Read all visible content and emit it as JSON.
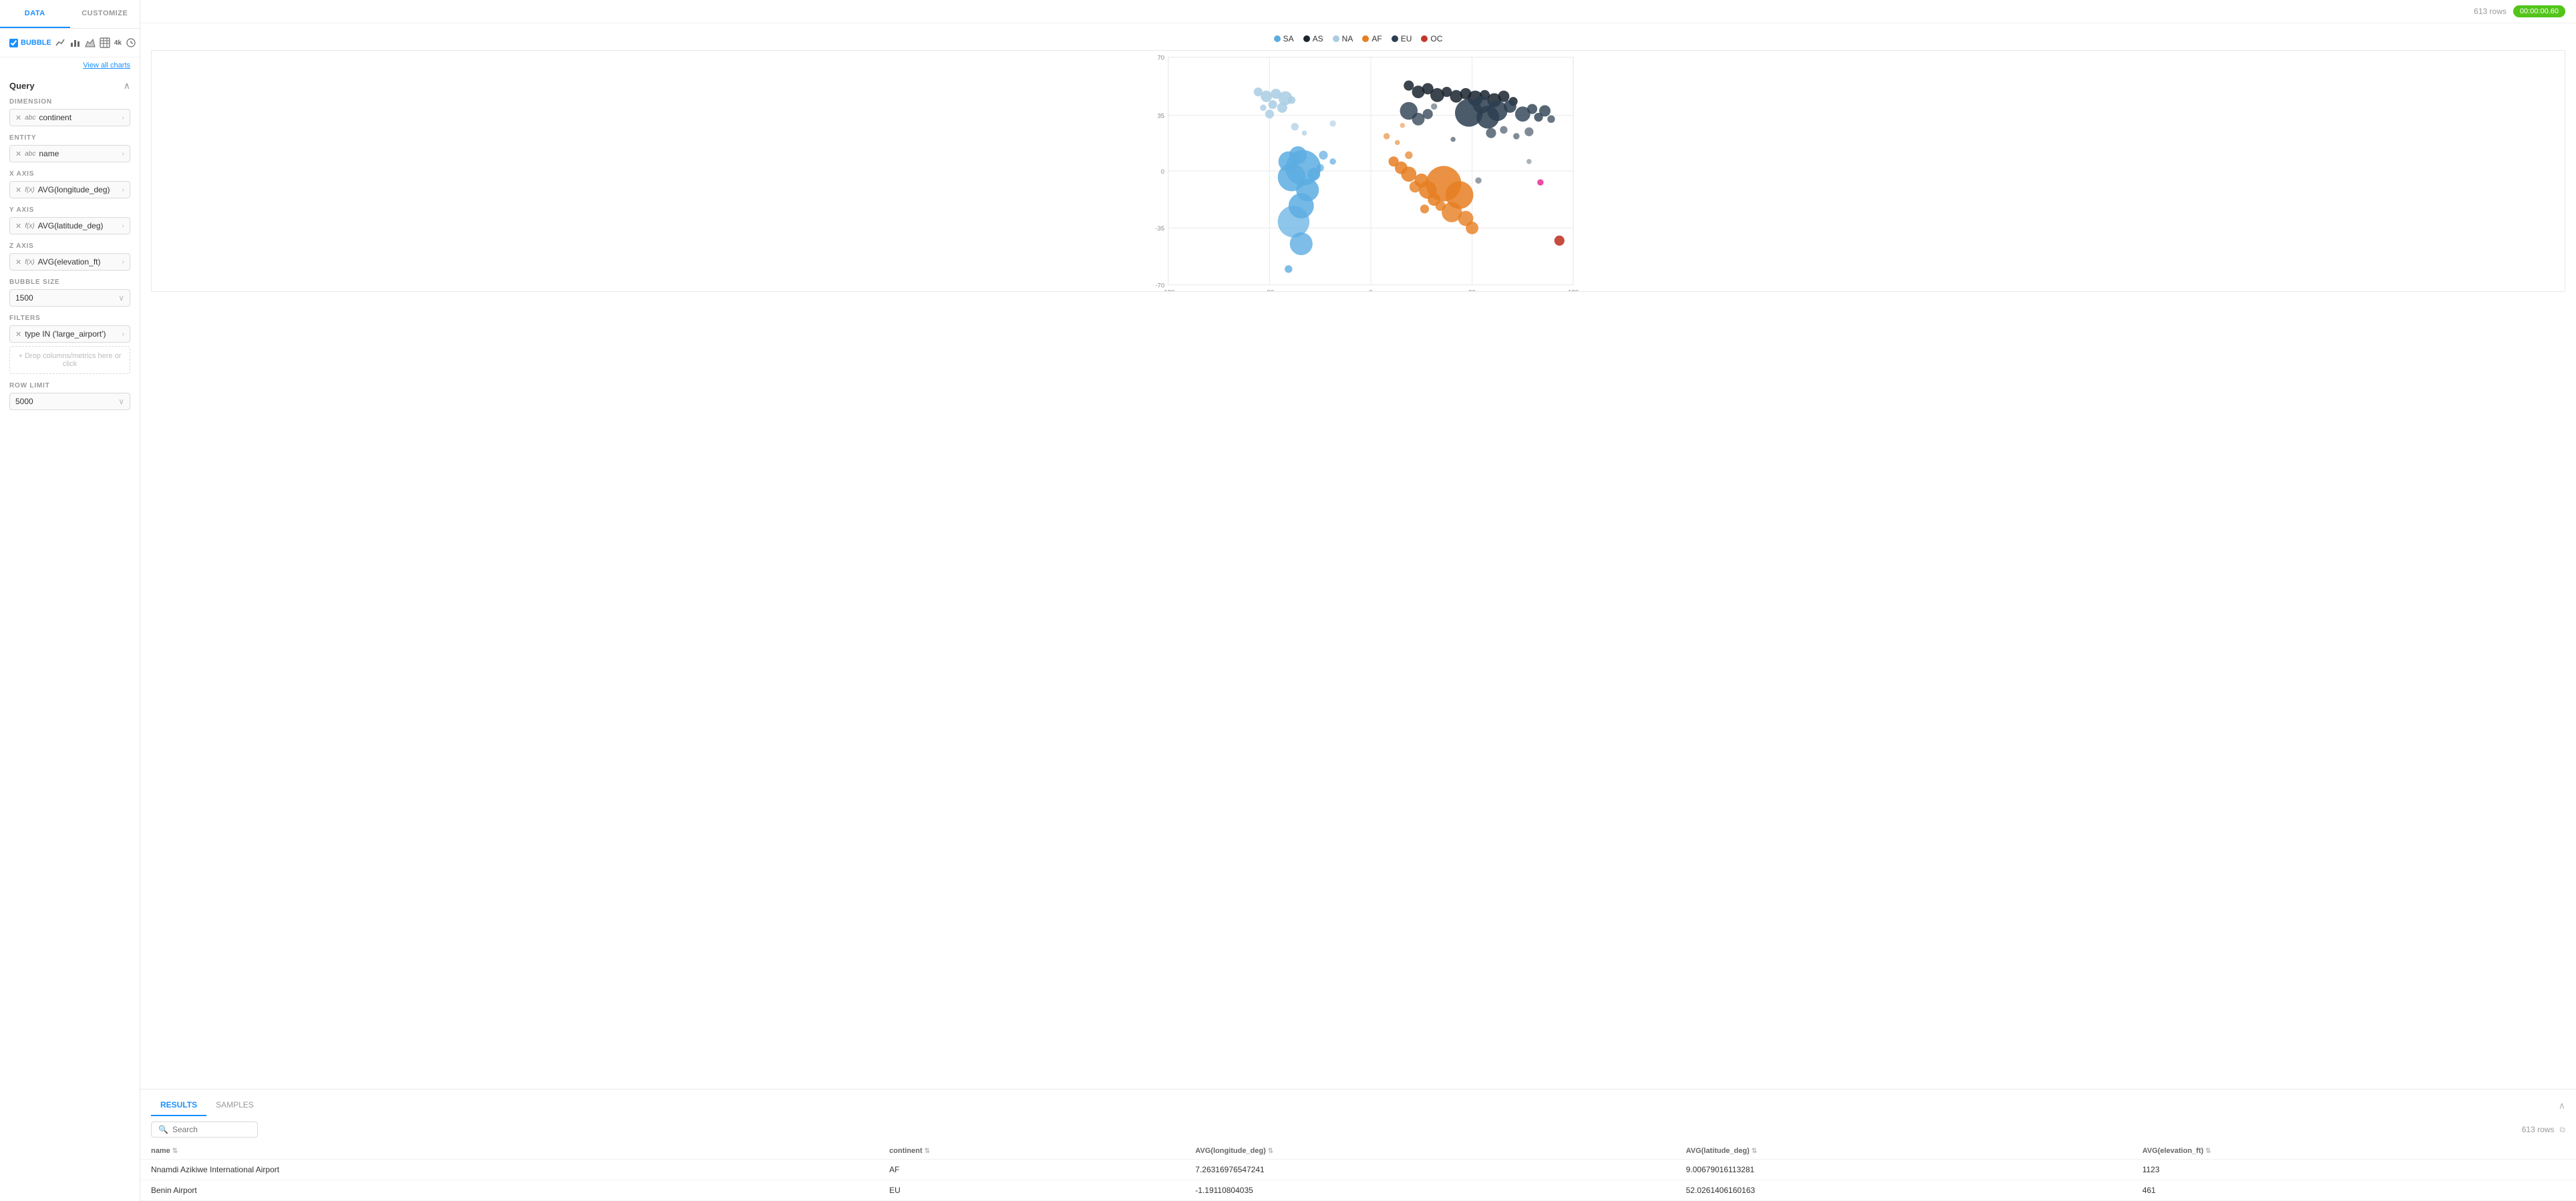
{
  "tabs": {
    "data_label": "DATA",
    "customize_label": "CUSTOMIZE"
  },
  "chart_types": [
    {
      "name": "bubble",
      "label": "BUBBLE",
      "icon": "⬤",
      "active": true
    },
    {
      "name": "line",
      "label": "line",
      "icon": "📈"
    },
    {
      "name": "bar",
      "label": "bar",
      "icon": "📊"
    },
    {
      "name": "area",
      "label": "area",
      "icon": "📉"
    },
    {
      "name": "table",
      "label": "table",
      "icon": "⊞"
    },
    {
      "name": "4k",
      "label": "4k",
      "icon": "4k"
    },
    {
      "name": "clock",
      "label": "clock",
      "icon": "🕐"
    }
  ],
  "view_all_charts": "View all charts",
  "query": {
    "title": "Query",
    "dimension_label": "DIMENSION",
    "dimension_value": "continent",
    "dimension_type": "abc",
    "entity_label": "ENTITY",
    "entity_value": "name",
    "entity_type": "abc",
    "xaxis_label": "X AXIS",
    "xaxis_value": "AVG(longitude_deg)",
    "xaxis_type": "f(x)",
    "yaxis_label": "Y AXIS",
    "yaxis_value": "AVG(latitude_deg)",
    "yaxis_type": "f(x)",
    "zaxis_label": "Z AXIS",
    "zaxis_value": "AVG(elevation_ft)",
    "zaxis_type": "f(x)",
    "bubble_size_label": "BUBBLE SIZE",
    "bubble_size_value": "1500",
    "filters_label": "FILTERS",
    "filter_value": "type IN ('large_airport')",
    "filter_type": "type",
    "drop_zone_text": "+ Drop columns/metrics here or click",
    "row_limit_label": "ROW LIMIT",
    "row_limit_value": "5000"
  },
  "header": {
    "rows_count": "613 rows",
    "timer": "00:00:00.60"
  },
  "legend": [
    {
      "label": "SA",
      "color": "#5DADE2"
    },
    {
      "label": "AS",
      "color": "#2C3E50"
    },
    {
      "label": "NA",
      "color": "#A9CCE3"
    },
    {
      "label": "AF",
      "color": "#E67E22"
    },
    {
      "label": "EU",
      "color": "#2C3E50"
    },
    {
      "label": "OC",
      "color": "#C0392B"
    }
  ],
  "results": {
    "results_tab": "RESULTS",
    "samples_tab": "SAMPLES",
    "search_placeholder": "Search",
    "rows_count": "613 rows",
    "columns": [
      "name",
      "continent",
      "AVG(longitude_deg)",
      "AVG(latitude_deg)",
      "AVG(elevation_ft)"
    ],
    "rows": [
      {
        "name": "Nnamdi Azikiwe International Airport",
        "continent": "AF",
        "avg_lon": "7.26316976547241",
        "avg_lat": "9.00679016113281",
        "avg_elev": "1123"
      },
      {
        "name": "Benin Airport",
        "continent": "EU",
        "avg_lon": "-1.19110804035",
        "avg_lat": "52.0261406160163",
        "avg_elev": "461"
      }
    ]
  }
}
